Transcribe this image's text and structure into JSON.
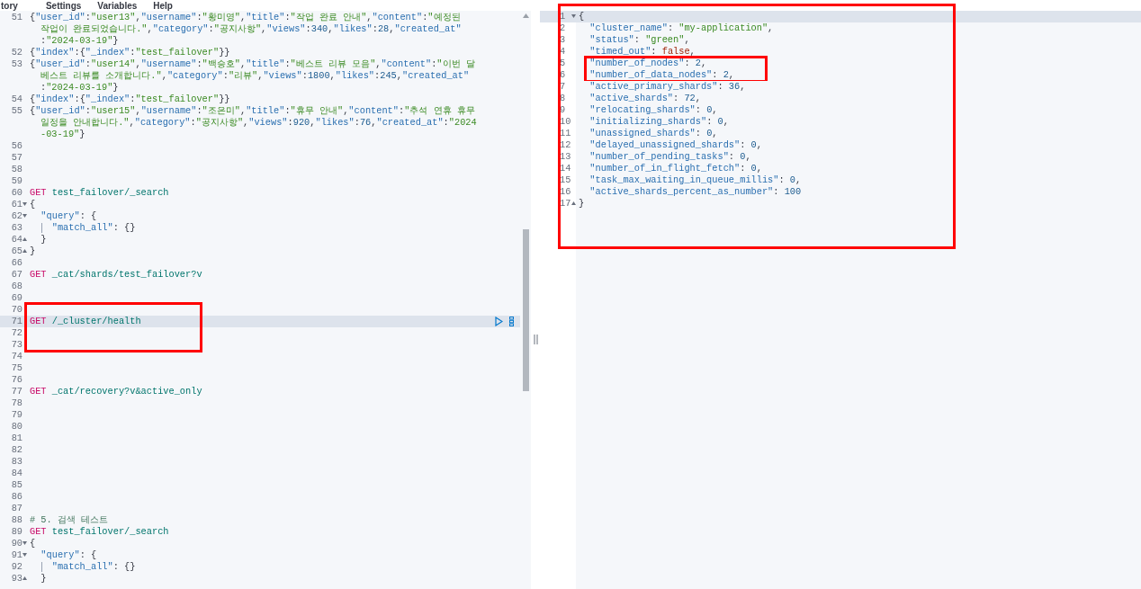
{
  "menu": [
    {
      "label": "tory"
    },
    {
      "label": "Settings"
    },
    {
      "label": "Variables"
    },
    {
      "label": "Help"
    }
  ],
  "editor": {
    "lines": [
      {
        "number": "51",
        "rows": [
          "{\"user_id\":\"user13\",\"username\":\"황미영\",\"title\":\"작업 완료 안내\",\"content\":\"예정된",
          "작업이 완료되었습니다.\",\"category\":\"공지사항\",\"views\":340,\"likes\":28,\"created_at\"",
          ":\"2024-03-19\"}"
        ],
        "active": false,
        "boxed": false
      },
      {
        "number": "52",
        "rows": [
          "{\"index\":{\"_index\":\"test_failover\"}}"
        ],
        "active": false,
        "boxed": false
      },
      {
        "number": "53",
        "rows": [
          "{\"user_id\":\"user14\",\"username\":\"백승호\",\"title\":\"베스트 리뷰 모음\",\"content\":\"이번 달",
          "베스트 리뷰를 소개합니다.\",\"category\":\"리뷰\",\"views\":1800,\"likes\":245,\"created_at\"",
          ":\"2024-03-19\"}"
        ],
        "active": false,
        "boxed": false
      },
      {
        "number": "54",
        "rows": [
          "{\"index\":{\"_index\":\"test_failover\"}}"
        ],
        "active": false,
        "boxed": false
      },
      {
        "number": "55",
        "rows": [
          "{\"user_id\":\"user15\",\"username\":\"조은미\",\"title\":\"휴무 안내\",\"content\":\"추석 연휴 휴무",
          "일정을 안내합니다.\",\"category\":\"공지사항\",\"views\":920,\"likes\":76,\"created_at\":\"2024",
          "-03-19\"}"
        ],
        "active": false,
        "boxed": false
      },
      {
        "number": "56",
        "active": false,
        "boxed": false
      },
      {
        "number": "57",
        "active": false,
        "boxed": false
      },
      {
        "number": "58",
        "active": false,
        "boxed": false
      },
      {
        "number": "59",
        "active": false,
        "boxed": false
      },
      {
        "number": "60",
        "rows": [
          "GET test_failover/_search"
        ],
        "active": false,
        "boxed": false
      },
      {
        "number": "61",
        "rows": [
          "{"
        ],
        "fold_start": true,
        "active": false,
        "boxed": false
      },
      {
        "number": "62",
        "rows": [
          "  \"query\": {"
        ],
        "fold_start": true,
        "active": false,
        "boxed": false
      },
      {
        "number": "63",
        "rows": [
          "    \"match_all\": {}"
        ],
        "indent_guide": true,
        "active": false,
        "boxed": false
      },
      {
        "number": "64",
        "rows": [
          "  }"
        ],
        "fold_end": true,
        "active": false,
        "boxed": false
      },
      {
        "number": "65",
        "rows": [
          "}"
        ],
        "fold_end": true,
        "active": false,
        "boxed": false
      },
      {
        "number": "66",
        "active": false,
        "boxed": false
      },
      {
        "number": "67",
        "rows": [
          "GET _cat/shards/test_failover?v"
        ],
        "active": false,
        "boxed": false
      },
      {
        "number": "68",
        "active": false,
        "boxed": false
      },
      {
        "number": "69",
        "active": false,
        "boxed": false
      },
      {
        "number": "70",
        "active": false,
        "boxed": true
      },
      {
        "number": "71",
        "rows": [
          "GET /_cluster/health"
        ],
        "active": true,
        "boxed": true
      },
      {
        "number": "72",
        "active": false,
        "boxed": true
      },
      {
        "number": "73",
        "active": false,
        "boxed": true
      },
      {
        "number": "74",
        "active": false,
        "boxed": false
      },
      {
        "number": "75",
        "active": false,
        "boxed": false
      },
      {
        "number": "76",
        "active": false,
        "boxed": false
      },
      {
        "number": "77",
        "rows": [
          "GET _cat/recovery?v&active_only"
        ],
        "active": false,
        "boxed": false
      },
      {
        "number": "78",
        "active": false,
        "boxed": false
      },
      {
        "number": "79",
        "active": false,
        "boxed": false
      },
      {
        "number": "80",
        "active": false,
        "boxed": false
      },
      {
        "number": "81",
        "active": false,
        "boxed": false
      },
      {
        "number": "82",
        "active": false,
        "boxed": false
      },
      {
        "number": "83",
        "active": false,
        "boxed": false
      },
      {
        "number": "84",
        "active": false,
        "boxed": false
      },
      {
        "number": "85",
        "active": false,
        "boxed": false
      },
      {
        "number": "86",
        "active": false,
        "boxed": false
      },
      {
        "number": "87",
        "active": false,
        "boxed": false
      },
      {
        "number": "88",
        "rows": [
          "# 5. 검색 테스트"
        ],
        "active": false,
        "boxed": false
      },
      {
        "number": "89",
        "rows": [
          "GET test_failover/_search"
        ],
        "active": false,
        "boxed": false
      },
      {
        "number": "90",
        "rows": [
          "{"
        ],
        "fold_start": true,
        "active": false,
        "boxed": false
      },
      {
        "number": "91",
        "rows": [
          "  \"query\": {"
        ],
        "fold_start": true,
        "active": false,
        "boxed": false
      },
      {
        "number": "92",
        "rows": [
          "    \"match_all\": {}"
        ],
        "indent_guide": true,
        "active": false,
        "boxed": false
      },
      {
        "number": "93",
        "rows": [
          "  }"
        ],
        "fold_end": true,
        "active": false,
        "boxed": false
      }
    ]
  },
  "response": {
    "framed": true,
    "lines": [
      {
        "number": "1",
        "rows": [
          "{"
        ],
        "fold_start": true,
        "active": true,
        "boxed": false
      },
      {
        "number": "2",
        "rows": [
          "  \"cluster_name\": \"my-application\","
        ],
        "active": false,
        "boxed": false
      },
      {
        "number": "3",
        "rows": [
          "  \"status\": \"green\","
        ],
        "active": false,
        "boxed": false
      },
      {
        "number": "4",
        "rows": [
          "  \"timed_out\": false,"
        ],
        "active": false,
        "boxed": false
      },
      {
        "number": "5",
        "rows": [
          "  \"number_of_nodes\": 2,"
        ],
        "active": false,
        "boxed": true
      },
      {
        "number": "6",
        "rows": [
          "  \"number_of_data_nodes\": 2,"
        ],
        "active": false,
        "boxed": true
      },
      {
        "number": "7",
        "rows": [
          "  \"active_primary_shards\": 36,"
        ],
        "active": false,
        "boxed": false
      },
      {
        "number": "8",
        "rows": [
          "  \"active_shards\": 72,"
        ],
        "active": false,
        "boxed": false
      },
      {
        "number": "9",
        "rows": [
          "  \"relocating_shards\": 0,"
        ],
        "active": false,
        "boxed": false
      },
      {
        "number": "10",
        "rows": [
          "  \"initializing_shards\": 0,"
        ],
        "active": false,
        "boxed": false
      },
      {
        "number": "11",
        "rows": [
          "  \"unassigned_shards\": 0,"
        ],
        "active": false,
        "boxed": false
      },
      {
        "number": "12",
        "rows": [
          "  \"delayed_unassigned_shards\": 0,"
        ],
        "active": false,
        "boxed": false
      },
      {
        "number": "13",
        "rows": [
          "  \"number_of_pending_tasks\": 0,"
        ],
        "active": false,
        "boxed": false
      },
      {
        "number": "14",
        "rows": [
          "  \"number_of_in_flight_fetch\": 0,"
        ],
        "active": false,
        "boxed": false
      },
      {
        "number": "15",
        "rows": [
          "  \"task_max_waiting_in_queue_millis\": 0,"
        ],
        "active": false,
        "boxed": false
      },
      {
        "number": "16",
        "rows": [
          "  \"active_shards_percent_as_number\": 100"
        ],
        "active": false,
        "boxed": false
      },
      {
        "number": "17",
        "rows": [
          "}"
        ],
        "fold_end": true,
        "active": false,
        "boxed": false
      }
    ]
  }
}
